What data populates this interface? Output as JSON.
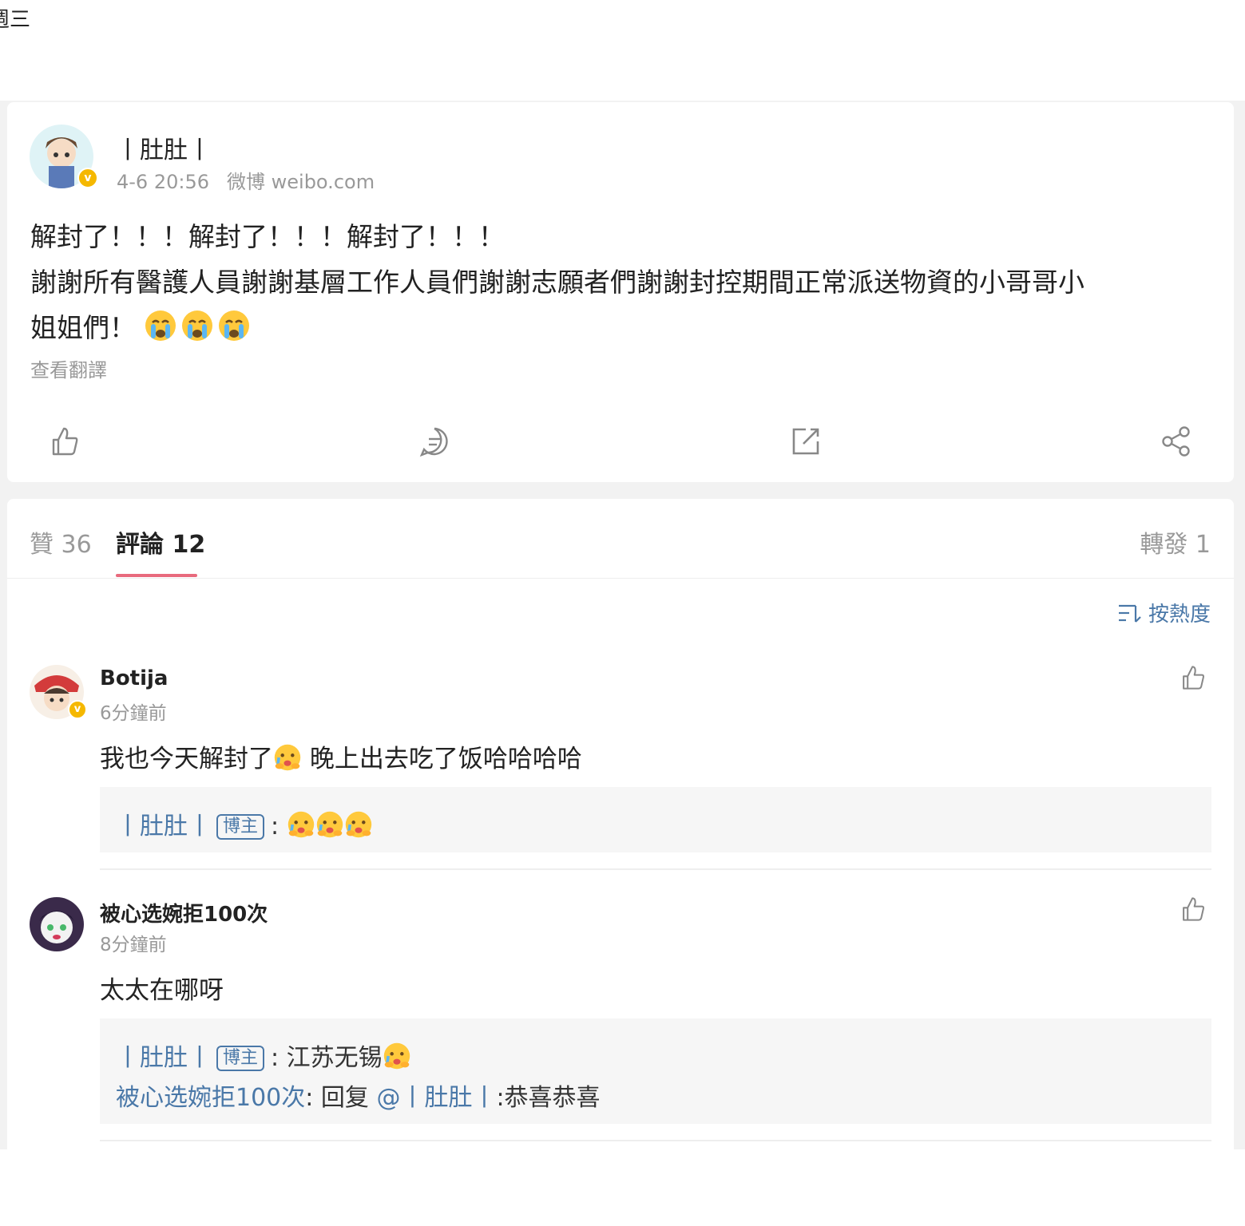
{
  "top_fragment": "週三",
  "post": {
    "author": "丨肚肚丨",
    "time": "4-6 20:56",
    "source": "微博 weibo.com",
    "line1": "解封了！！！解封了！！！解封了！！！",
    "line2": "謝謝所有醫護人員謝謝基層工作人員們謝謝志願者們謝謝封控期間正常派送物資的小哥哥小",
    "line3": "姐姐們！",
    "translate_label": "查看翻譯",
    "actions": [
      "like-icon",
      "comment-icon",
      "repost-icon",
      "share-icon"
    ]
  },
  "tabs": {
    "likes": "贊 36",
    "comments": "評論 12",
    "reposts": "轉發 1"
  },
  "sort_label": "按熱度",
  "comments": [
    {
      "name": "Botija",
      "time": "6分鐘前",
      "text_a": "我也今天解封了",
      "text_b": " 晚上出去吃了饭哈哈哈哈",
      "replies": [
        {
          "user": "丨肚肚丨",
          "badge": "博主",
          "sep": ":",
          "text": ""
        }
      ]
    },
    {
      "name": "被心选婉拒100次",
      "time": "8分鐘前",
      "text": "太太在哪呀",
      "replies": [
        {
          "user": "丨肚肚丨",
          "badge": "博主",
          "sep": ":",
          "text": " 江苏无锡"
        },
        {
          "user": "被心选婉拒100次",
          "sep": ":",
          "text_pre": " 回复 ",
          "mention": "@丨肚肚丨",
          "text_post": ":恭喜恭喜"
        }
      ]
    }
  ],
  "colors": {
    "link": "#4a78a8",
    "tab_underline": "#e86a7d",
    "verified_badge": "#f5b800"
  }
}
